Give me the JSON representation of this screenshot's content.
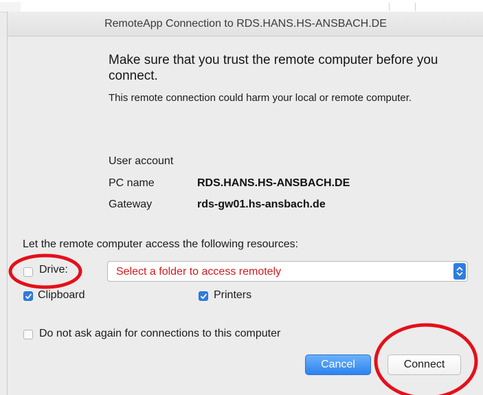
{
  "window": {
    "title": "RemoteApp Connection to RDS.HANS.HS-ANSBACH.DE"
  },
  "message": {
    "heading": "Make sure that you trust the remote computer before you connect.",
    "warning": "This remote connection could harm your local or remote computer."
  },
  "details": {
    "user_account_label": "User account",
    "user_account_value": "",
    "pc_name_label": "PC name",
    "pc_name_value": "RDS.HANS.HS-ANSBACH.DE",
    "gateway_label": "Gateway",
    "gateway_value": "rds-gw01.hs-ansbach.de"
  },
  "resources": {
    "label": "Let the remote computer access the following resources:",
    "drive": {
      "label": "Drive:",
      "checked": false
    },
    "folder_select": {
      "value": "Select a folder to access remotely",
      "text_color": "#d6181a"
    },
    "clipboard": {
      "label": "Clipboard",
      "checked": true
    },
    "printers": {
      "label": "Printers",
      "checked": true
    }
  },
  "do_not_ask": {
    "label": "Do not ask again for connections to this computer",
    "checked": false
  },
  "buttons": {
    "cancel_label": "Cancel",
    "connect_label": "Connect"
  },
  "colors": {
    "accent": "#2f7de1",
    "annotation_red": "#e4101a",
    "dialog_background": "#ececec"
  },
  "icons": {
    "select_arrows": "chevron-up-down-icon",
    "checkmark": "checkmark-icon"
  }
}
